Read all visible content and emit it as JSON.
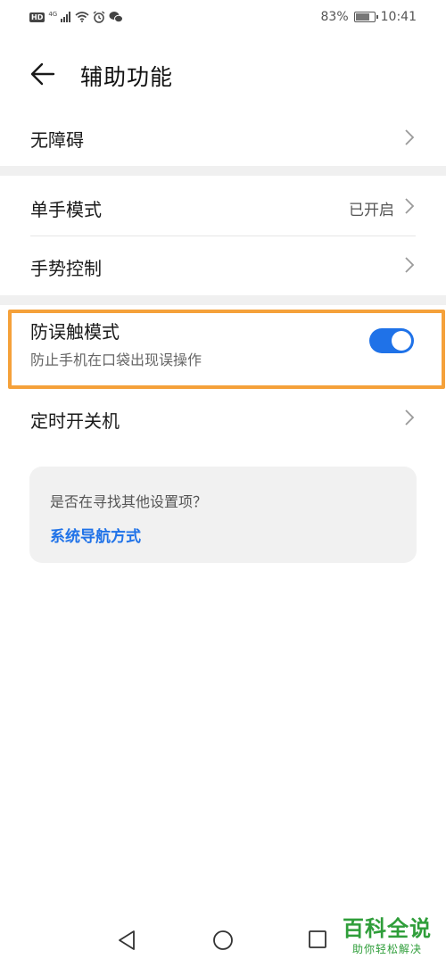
{
  "status_bar": {
    "hd": "HD",
    "network": "4G",
    "battery_percent": "83%",
    "battery_level": 0.83,
    "time": "10:41"
  },
  "header": {
    "title": "辅助功能",
    "back_icon": "arrow-left-icon"
  },
  "settings": {
    "accessibility": {
      "label": "无障碍"
    },
    "one_hand": {
      "label": "单手模式",
      "value": "已开启"
    },
    "gesture": {
      "label": "手势控制"
    },
    "pocket_mode": {
      "label": "防误触模式",
      "description": "防止手机在口袋出现误操作",
      "enabled": true
    },
    "schedule_power": {
      "label": "定时开关机"
    }
  },
  "suggestion": {
    "question": "是否在寻找其他设置项？",
    "link": "系统导航方式"
  },
  "nav_bar": {
    "back": "triangle-back-icon",
    "home": "circle-home-icon",
    "recent": "square-recent-icon"
  },
  "watermark": {
    "main": "百科全说",
    "sub": "助你轻松解决"
  },
  "colors": {
    "accent": "#1f72e8",
    "highlight": "#f5a13a",
    "watermark": "#2f9e3a"
  }
}
